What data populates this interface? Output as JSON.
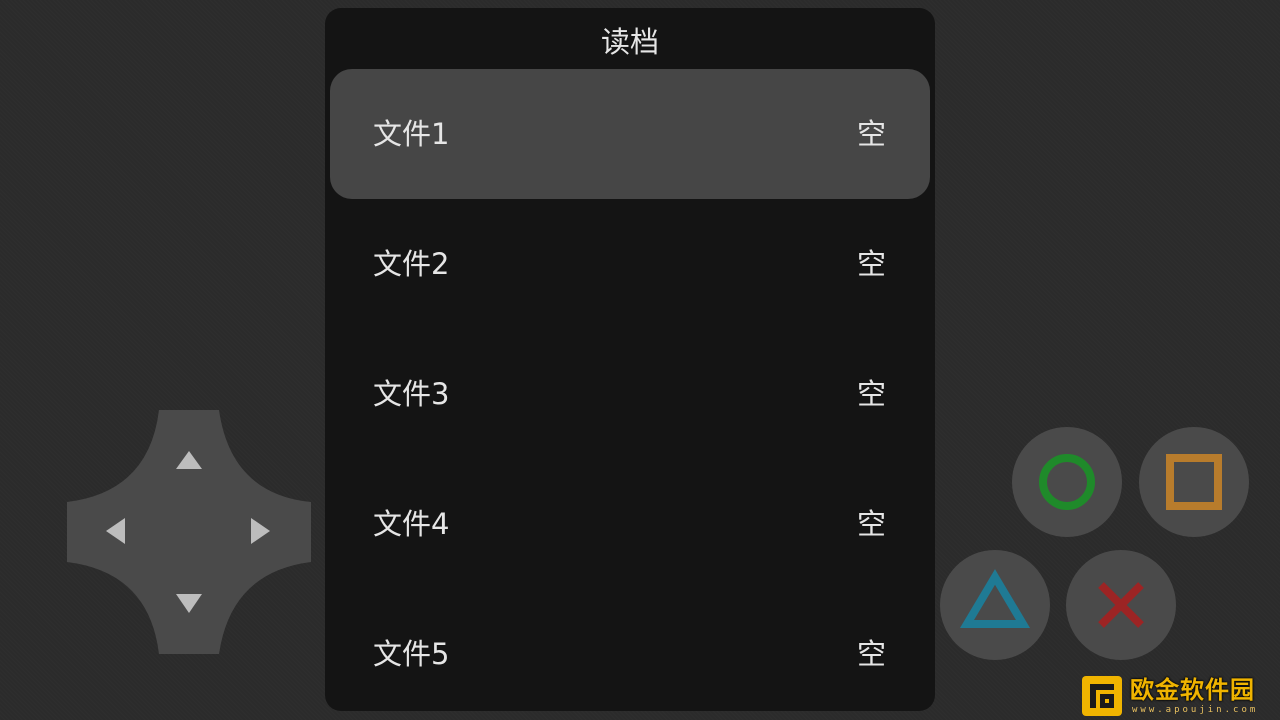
{
  "dialog": {
    "title": "读档",
    "slots": [
      {
        "name": "文件1",
        "status": "空",
        "selected": true
      },
      {
        "name": "文件2",
        "status": "空",
        "selected": false
      },
      {
        "name": "文件3",
        "status": "空",
        "selected": false
      },
      {
        "name": "文件4",
        "status": "空",
        "selected": false
      },
      {
        "name": "文件5",
        "status": "空",
        "selected": false
      }
    ]
  },
  "controls": {
    "dpad": {
      "icons": [
        "arrow-up-icon",
        "arrow-down-icon",
        "arrow-left-icon",
        "arrow-right-icon"
      ]
    },
    "face_buttons": [
      {
        "icon": "circle-icon",
        "color": "#1f8a2a"
      },
      {
        "icon": "square-icon",
        "color": "#b87c2c"
      },
      {
        "icon": "triangle-icon",
        "color": "#1f7a94"
      },
      {
        "icon": "cross-icon",
        "color": "#9c2424"
      }
    ]
  },
  "colors": {
    "background": "#2b2b2b",
    "dialog": "#141414",
    "selected_slot": "#464646",
    "text": "#e6e6e6",
    "control": "#4a4a4a",
    "watermark": "#f0b400"
  },
  "watermark": {
    "text": "欧金软件园",
    "url": "www.apoujin.com"
  }
}
